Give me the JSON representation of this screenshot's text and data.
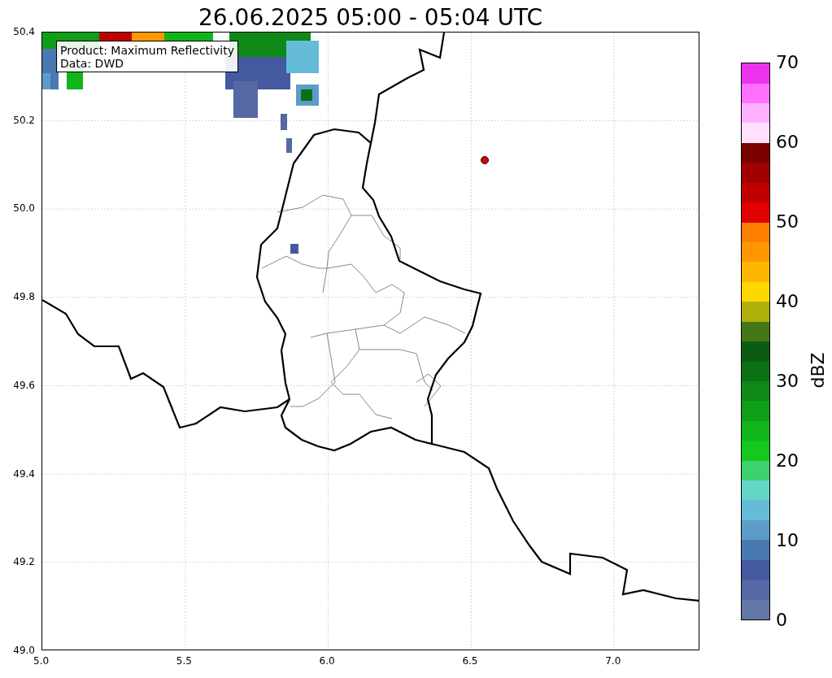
{
  "title": "26.06.2025 05:00 - 05:04 UTC",
  "info_box": [
    "Product: Maximum Reflectivity",
    "Data: DWD"
  ],
  "x_ticks": [
    "5.0",
    "5.5",
    "6.0",
    "6.5",
    "7.0"
  ],
  "y_ticks": [
    "50.4",
    "50.2",
    "50.0",
    "49.8",
    "49.6",
    "49.4",
    "49.2",
    "49.0"
  ],
  "colorbar": {
    "label": "dBZ",
    "ticks": [
      "70",
      "60",
      "50",
      "40",
      "30",
      "20",
      "10",
      "0"
    ],
    "levels": [
      {
        "color": "#6577a8"
      },
      {
        "color": "#5468a4"
      },
      {
        "color": "#4459a0"
      },
      {
        "color": "#4a78b0"
      },
      {
        "color": "#5b9dc8"
      },
      {
        "color": "#64bcd9"
      },
      {
        "color": "#63d6c6"
      },
      {
        "color": "#3dd16f"
      },
      {
        "color": "#14c81e"
      },
      {
        "color": "#10b41b"
      },
      {
        "color": "#0f9e17"
      },
      {
        "color": "#0e8816"
      },
      {
        "color": "#0c7014"
      },
      {
        "color": "#0b5c10"
      },
      {
        "color": "#457716"
      },
      {
        "color": "#b0b00a"
      },
      {
        "color": "#ffd700"
      },
      {
        "color": "#ffb600"
      },
      {
        "color": "#ff9800"
      },
      {
        "color": "#ff7f00"
      },
      {
        "color": "#e00000"
      },
      {
        "color": "#c00000"
      },
      {
        "color": "#a00000"
      },
      {
        "color": "#7a0000"
      },
      {
        "color": "#ffe0ff"
      },
      {
        "color": "#ffb0ff"
      },
      {
        "color": "#ff70ff"
      },
      {
        "color": "#ee33ee"
      }
    ]
  }
}
